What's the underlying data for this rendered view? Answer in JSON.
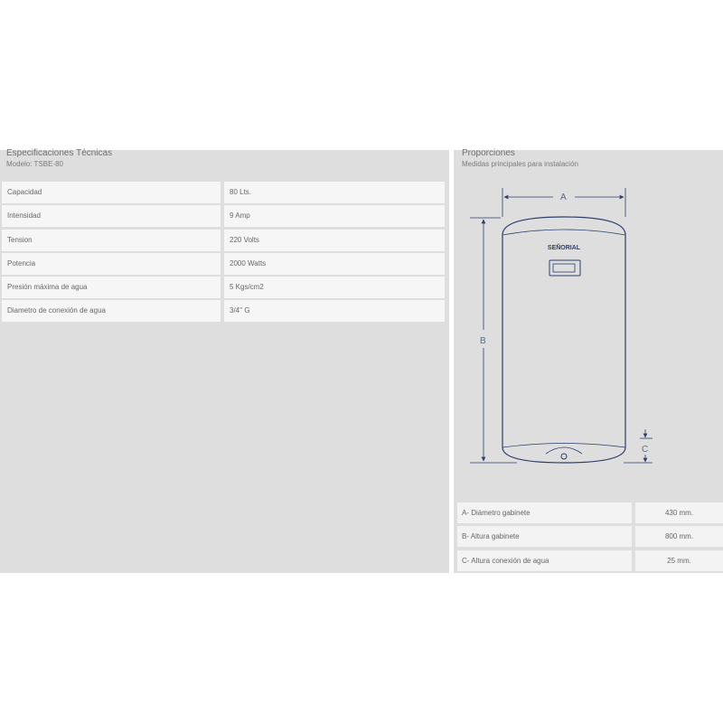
{
  "specs": {
    "title": "Especificaciones Técnicas",
    "model": "Modelo: TSBE-80",
    "rows": [
      {
        "label": "Capacidad",
        "value": "80 Lts."
      },
      {
        "label": "Intensidad",
        "value": "9 Amp"
      },
      {
        "label": "Tension",
        "value": "220 Volts"
      },
      {
        "label": "Potencia",
        "value": "2000 Watts"
      },
      {
        "label": "Presión máxima de agua",
        "value": "5 Kgs/cm2"
      },
      {
        "label": "Diametro de conexión de agua",
        "value": "3/4'' G"
      }
    ]
  },
  "proportions": {
    "title": "Proporciones",
    "subtitle": "Medidas principales para instalación",
    "diagram": {
      "brand": "SEÑORIAL",
      "label_a": "A",
      "label_b": "B",
      "label_c": "C"
    },
    "rows": [
      {
        "label": "A- Diámetro gabinete",
        "value": "430 mm."
      },
      {
        "label": "B- Altura gabinete",
        "value": "800 mm."
      },
      {
        "label": "C- Altura conexión de agua",
        "value": "25 mm."
      }
    ]
  },
  "colors": {
    "panel": "#dedede",
    "row": "#f6f6f6",
    "diagram_line": "#2c3e6b"
  }
}
